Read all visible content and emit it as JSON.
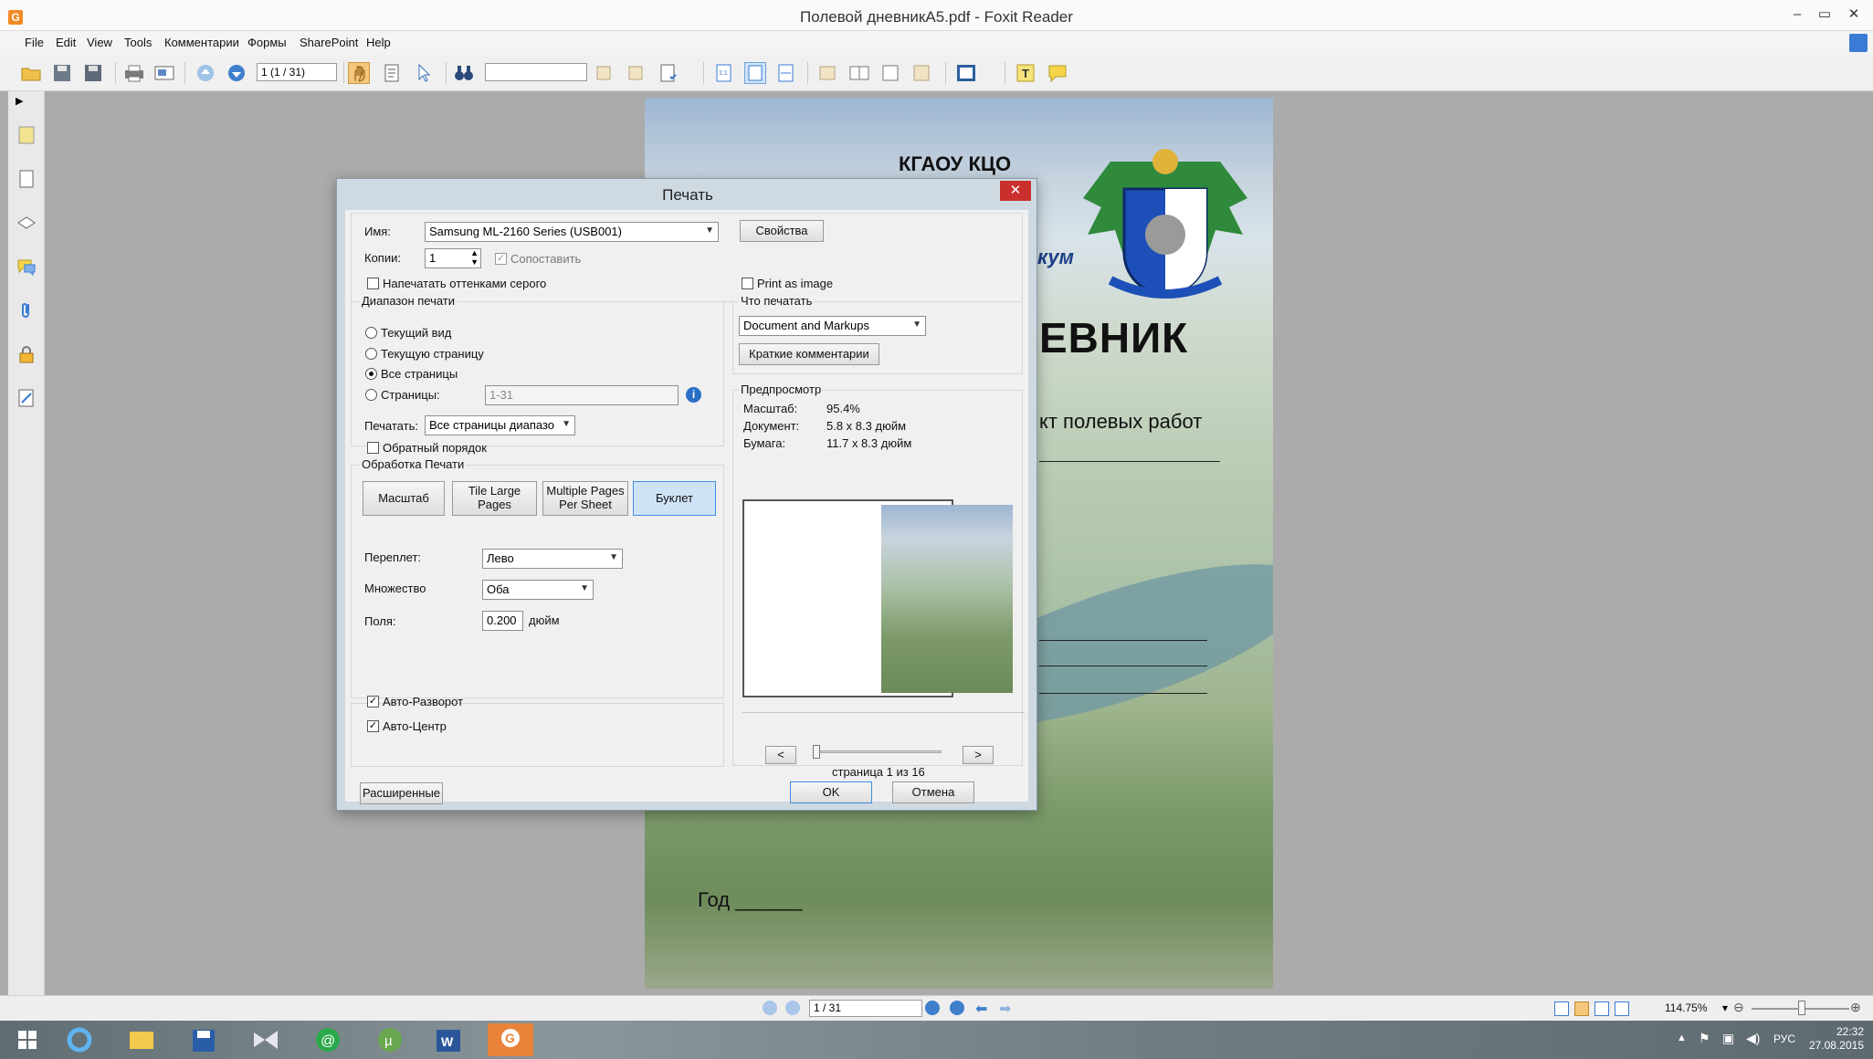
{
  "window": {
    "title": "Полевой дневникА5.pdf - Foxit Reader",
    "logo_letter": "G",
    "minimize": "–",
    "restore": "▭",
    "close": "✕"
  },
  "menu": [
    "File",
    "Edit",
    "View",
    "Tools",
    "Комментарии",
    "Формы",
    "SharePoint",
    "Help"
  ],
  "toolbar": {
    "page_value": "1 (1 / 31)",
    "find_value": ""
  },
  "pdf": {
    "org": "КГАОУ КЦО",
    "kum": "кум",
    "title": "ЕВНИК",
    "subtitle": "кт полевых работ",
    "year_label": "Год ______"
  },
  "dialog": {
    "title": "Печать",
    "close": "✕",
    "printer_label": "Имя:",
    "printer_value": "Samsung ML-2160 Series (USB001)",
    "properties_button": "Свойства",
    "copies_label": "Копии:",
    "copies_value": "1",
    "collate_label": "Сопоставить",
    "collate_checked": true,
    "grayscale_label": "Напечатать оттенками серого",
    "grayscale_checked": false,
    "print_as_image_label": "Print as image",
    "print_as_image_checked": false,
    "range": {
      "title": "Диапазон печати",
      "current_view": "Текущий вид",
      "current_page": "Текущую страницу",
      "all_pages": "Все страницы",
      "pages": "Страницы:",
      "pages_value": "1-31",
      "selected": "all_pages",
      "print_label": "Печатать:",
      "print_value": "Все страницы диапазо",
      "reverse_label": "Обратный порядок",
      "reverse_checked": false
    },
    "handling": {
      "title": "Обработка Печати",
      "scale_button": "Масштаб",
      "tile_button_line1": "Tile Large",
      "tile_button_line2": "Pages",
      "multiple_button_line1": "Multiple Pages",
      "multiple_button_line2": "Per Sheet",
      "booklet_button": "Буклет",
      "active": "booklet",
      "binding_label": "Переплет:",
      "binding_value": "Лево",
      "set_label": "Множество",
      "set_value": "Оба",
      "margins_label": "Поля:",
      "margins_value": "0.200",
      "margins_unit": "дюйм"
    },
    "auto_rotate_label": "Авто-Разворот",
    "auto_rotate_checked": true,
    "auto_center_label": "Авто-Центр",
    "auto_center_checked": true,
    "what_to_print": {
      "title": "Что печатать",
      "value": "Document and Markups",
      "summary_button": "Краткие комментарии"
    },
    "preview": {
      "title": "Предпросмотр",
      "scale_label": "Масштаб:",
      "scale_value": "95.4%",
      "document_label": "Документ:",
      "document_value": "5.8 x 8.3 дюйм",
      "paper_label": "Бумага:",
      "paper_value": "11.7 x 8.3 дюйм",
      "prev_button": "<",
      "next_button": ">",
      "page_text": "страница 1 из 16"
    },
    "advanced_button": "Расширенные",
    "ok_button": "OK",
    "cancel_button": "Отмена"
  },
  "statusbar": {
    "page_value": "1 / 31",
    "zoom": "114.75%"
  },
  "taskbar": {
    "lang": "РУС",
    "time": "22:32",
    "date": "27.08.2015"
  },
  "colors": {
    "accent": "#3d8ee0",
    "close_red": "#c9302c",
    "foxit_orange": "#f08a24"
  }
}
